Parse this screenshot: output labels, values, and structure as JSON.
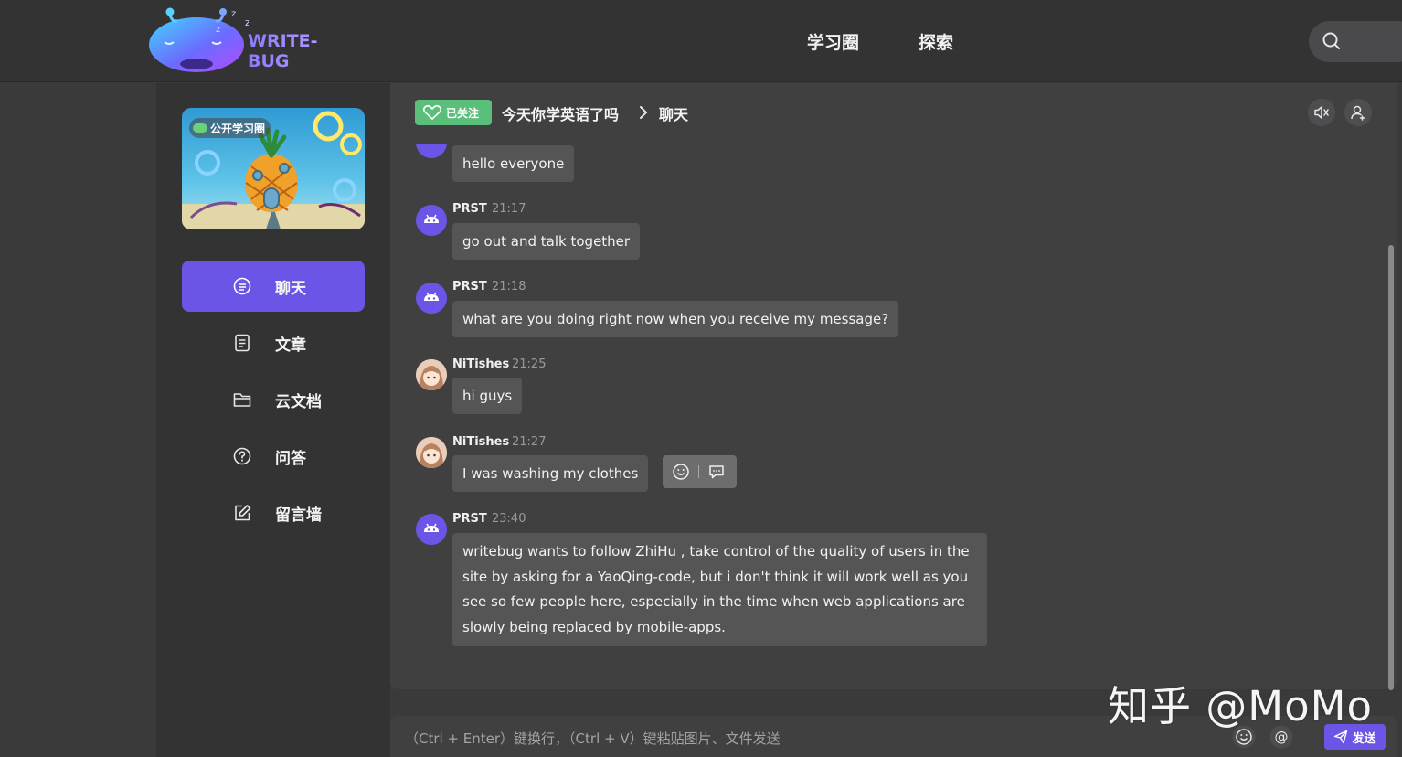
{
  "header": {
    "logo_text": "WRITE-BUG",
    "nav": [
      "学习圈",
      "探索"
    ],
    "search_icon": "search-icon"
  },
  "sidebar": {
    "cover_badge": "公开学习圈",
    "items": [
      {
        "label": "聊天",
        "icon": "chat-bubble-icon",
        "active": true
      },
      {
        "label": "文章",
        "icon": "document-icon",
        "active": false
      },
      {
        "label": "云文档",
        "icon": "folder-icon",
        "active": false
      },
      {
        "label": "问答",
        "icon": "question-icon",
        "active": false
      },
      {
        "label": "留言墙",
        "icon": "edit-icon",
        "active": false
      }
    ]
  },
  "chat": {
    "follow_label": "已关注",
    "circle_name": "今天你学英语了吗",
    "channel": "聊天",
    "messages": [
      {
        "author": "",
        "time": "",
        "text": "hello everyone",
        "avatar": "bot"
      },
      {
        "author": "PRST",
        "time": "21:17",
        "text": "go out and talk together",
        "avatar": "bot"
      },
      {
        "author": "PRST",
        "time": "21:18",
        "text": "what are you doing right now when you receive my message?",
        "avatar": "bot"
      },
      {
        "author": "NiTishes",
        "time": "21:25",
        "text": "hi guys",
        "avatar": "girl"
      },
      {
        "author": "NiTishes",
        "time": "21:27",
        "text": "I was washing my clothes",
        "avatar": "girl"
      },
      {
        "author": "PRST",
        "time": "23:40",
        "text": "writebug wants to follow ZhiHu , take control of the quality of users in the site by asking for a YaoQing-code, but i don't think it will work well as you see so few people here, especially in the time when web applications are slowly being replaced by mobile-apps.",
        "avatar": "bot"
      }
    ]
  },
  "input": {
    "placeholder": "（Ctrl + Enter）键换行，（Ctrl + V）键粘贴图片、文件发送",
    "send_label": "发送"
  },
  "watermark": "知乎 @MoMo",
  "colors": {
    "accent": "#6a55e6",
    "follow_green": "#5bbf7c",
    "background": "#3a3a3b"
  }
}
